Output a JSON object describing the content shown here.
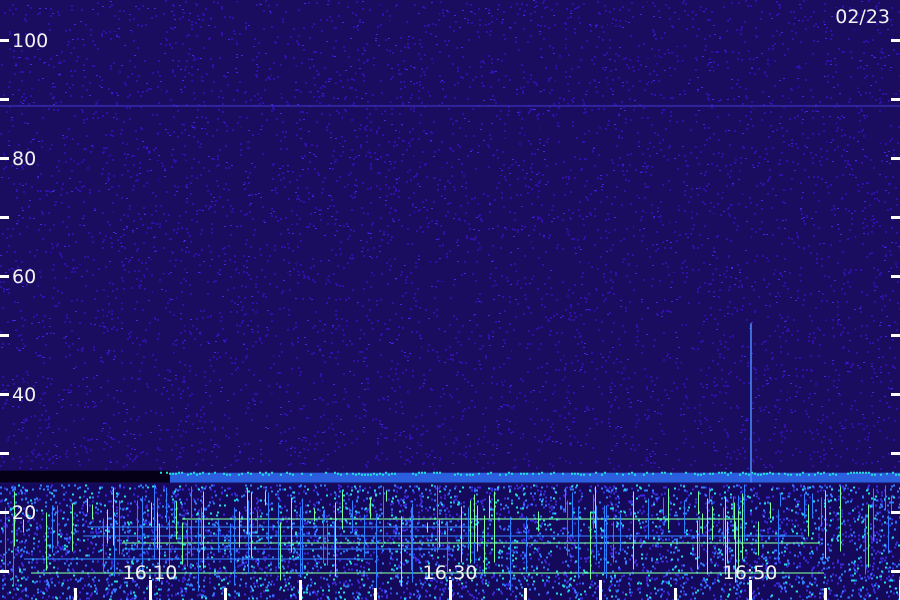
{
  "chart_data": {
    "type": "heatmap",
    "title": "",
    "date_label": "02/23",
    "xlabel": "",
    "ylabel": "",
    "x_tick_labels": [
      "16:10",
      "16:30",
      "16:50"
    ],
    "y_tick_labels": [
      "20",
      "40",
      "60",
      "80",
      "100"
    ],
    "x_range": [
      "16:02",
      "17:02"
    ],
    "y_range": [
      0,
      102
    ],
    "x_minor_tick_minutes": 5,
    "y_minor_tick_step": 10,
    "grid": false,
    "legend": "none",
    "colormap": [
      "#000000",
      "#1a0a66",
      "#2f0fa8",
      "#3b2be0",
      "#2f7fff",
      "#20e0e0",
      "#7dffa0"
    ],
    "features": {
      "noise_floor_band_y": [
        25,
        27
      ],
      "interference_zone_y": [
        0,
        25
      ],
      "vertical_streak": {
        "time": "16:50",
        "y": [
          25,
          52
        ]
      },
      "faint_horizontal_line_y": 89
    }
  }
}
